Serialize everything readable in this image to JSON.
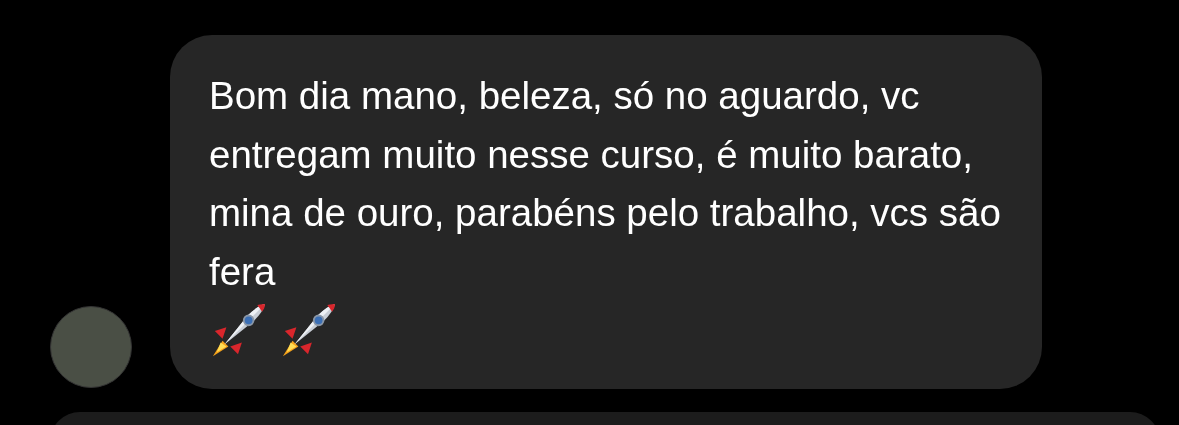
{
  "messages": [
    {
      "text": "Bom dia mano, beleza, só no aguardo, vc entregam muito nesse curso, é muito barato, mina de ouro, parabéns pelo trabalho, vcs são fera",
      "emojis": [
        {
          "kind": "rocket"
        },
        {
          "kind": "rocket"
        }
      ]
    }
  ]
}
